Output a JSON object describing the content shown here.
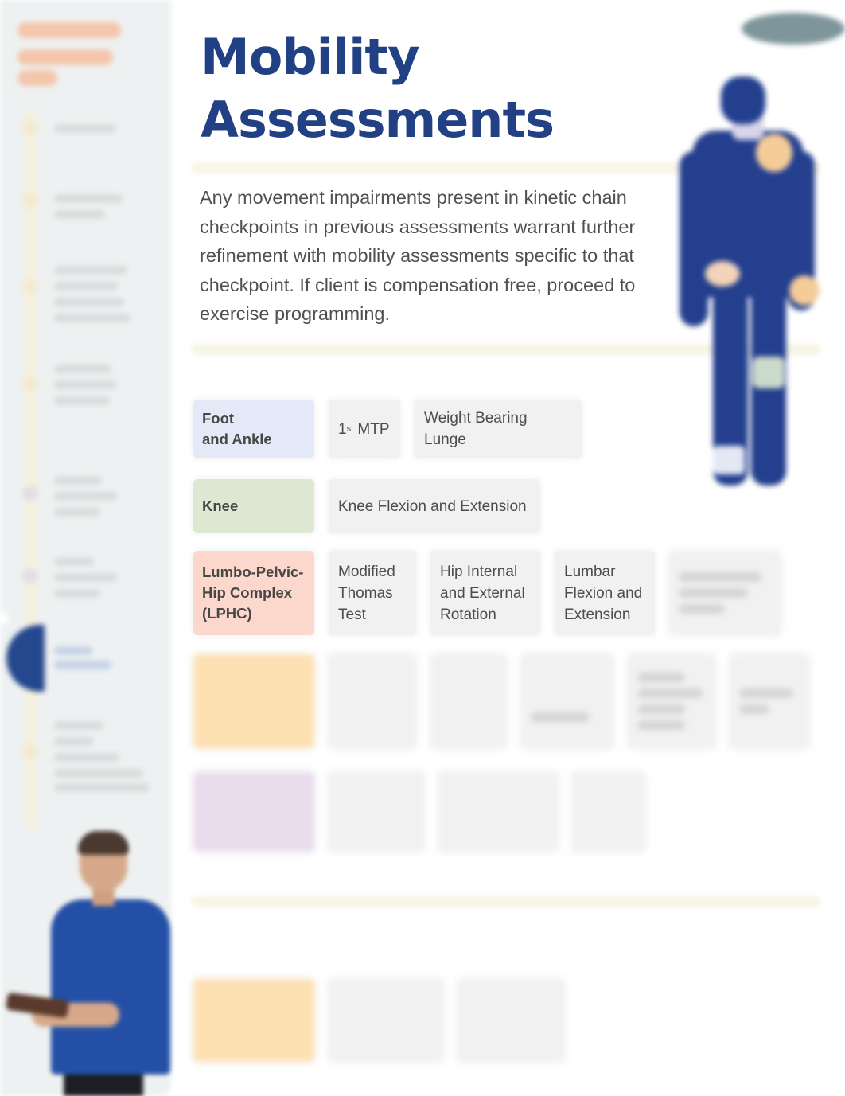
{
  "page": {
    "title_line1": "Mobility",
    "title_line2": "Assessments",
    "intro": "Any movement impairments present in kinetic chain checkpoints in previous assessments warrant further refinement with mobility assessments specific to that checkpoint. If client is compensation free, proceed to exercise programming."
  },
  "colors": {
    "title": "#224184",
    "foot_ankle": "#e3e9f6",
    "knee": "#dde8d3",
    "lphc": "#fbd8cb",
    "row4_category": "#fde0b2",
    "row5_category": "#e9dcec"
  },
  "assessment_rows": [
    {
      "category": [
        "Foot",
        "and Ankle"
      ],
      "tests": [
        {
          "label": "1",
          "superscript": "st",
          "suffix": " MTP"
        },
        {
          "label": "Weight Bearing Lunge"
        }
      ]
    },
    {
      "category": [
        "Knee"
      ],
      "tests": [
        {
          "label": "Knee Flexion and Extension"
        }
      ]
    },
    {
      "category": [
        "Lumbo-Pelvic-",
        "Hip Complex",
        "(LPHC)"
      ],
      "tests": [
        {
          "lines": [
            "Modified",
            "Thomas",
            "Test"
          ]
        },
        {
          "lines": [
            "Hip Internal",
            "and External",
            "Rotation"
          ]
        },
        {
          "lines": [
            "Lumbar",
            "Flexion and",
            "Extension"
          ]
        },
        {
          "obscured": true
        }
      ]
    }
  ],
  "obscured_sections": {
    "sidebar": "navigation content obscured (blurred)",
    "row4": "obscured",
    "row5": "obscured",
    "bottom_row": "obscured"
  }
}
